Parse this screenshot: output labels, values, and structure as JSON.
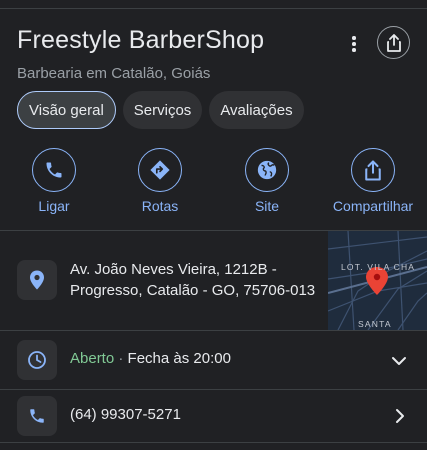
{
  "place": {
    "name": "Freestyle BarberShop",
    "category": "Barbearia em Catalão, Goiás"
  },
  "tabs": [
    {
      "label": "Visão geral",
      "active": true
    },
    {
      "label": "Serviços",
      "active": false
    },
    {
      "label": "Avaliações",
      "active": false
    }
  ],
  "actions": [
    {
      "label": "Ligar",
      "icon": "phone-icon"
    },
    {
      "label": "Rotas",
      "icon": "directions-icon"
    },
    {
      "label": "Site",
      "icon": "globe-icon"
    },
    {
      "label": "Compartilhar",
      "icon": "share-icon"
    }
  ],
  "address": {
    "line1": "Av. João Neves Vieira, 1212B -",
    "line2": "Progresso, Catalão - GO, 75706-013"
  },
  "map": {
    "label_top": "LOT. VILA CHA",
    "label_bottom": "SANTA"
  },
  "hours": {
    "status": "Aberto",
    "separator": "·",
    "closes": "Fecha às 20:00"
  },
  "phone": {
    "number": "(64) 99307-5271"
  },
  "colors": {
    "background": "#202124",
    "accent": "#8ab4f8",
    "open_green": "#81c995",
    "pin_red": "#ea4335"
  }
}
